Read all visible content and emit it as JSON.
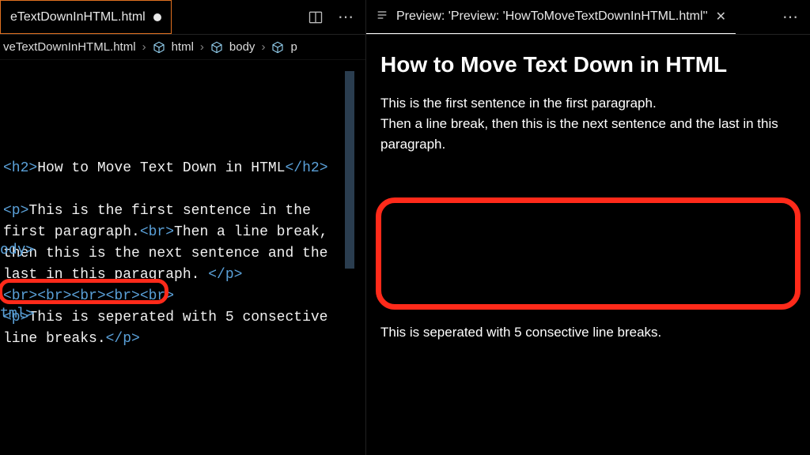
{
  "left": {
    "tab": {
      "label": "eTextDownInHTML.html"
    },
    "breadcrumb": {
      "file": "veTextDownInHTML.html",
      "b1": "html",
      "b2": "body",
      "b3": "p"
    },
    "code": {
      "h2_open": "<h2>",
      "h2_text": "How to Move Text Down in HTML",
      "h2_close": "</h2>",
      "p_open": "<p>",
      "p1a": "This is the first sentence in the first paragraph.",
      "br": "<br>",
      "p1b": "Then a line break, then this is the next sentence and the last in this paragraph. ",
      "p_close": "</p>",
      "brline": "<br><br><br><br><br>",
      "p2_open": "<p>",
      "p2_text": "This is seperated with 5 consective line breaks.",
      "p2_close": "</p>",
      "body_close": "ody>",
      "html_close": "tml>"
    }
  },
  "right": {
    "tab": {
      "label": "Preview: 'Preview: 'HowToMoveTextDownInHTML.html''"
    },
    "preview": {
      "heading": "How to Move Text Down in HTML",
      "para1_line1": "This is the first sentence in the first paragraph.",
      "para1_line2": "Then a line break, then this is the next sentence and the last in this paragraph.",
      "para2": "This is seperated with 5 consective line breaks."
    }
  }
}
